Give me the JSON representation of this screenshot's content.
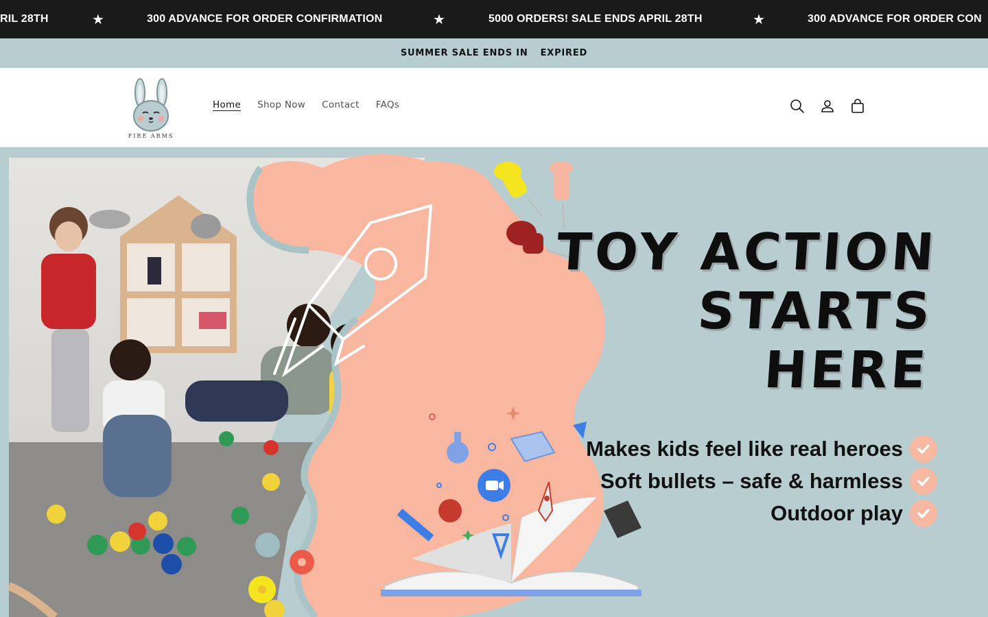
{
  "ticker": {
    "items": [
      "RIL 28TH",
      "300 ADVANCE FOR ORDER CONFIRMATION",
      "5000 ORDERS! SALE ENDS APRIL 28TH",
      "300 ADVANCE FOR ORDER CON"
    ],
    "separator": "★"
  },
  "countdown": {
    "label": "SUMMER SALE ENDS IN",
    "status": "EXPIRED"
  },
  "header": {
    "logo_text": "FIRE ARMS",
    "nav": [
      {
        "label": "Home",
        "active": true
      },
      {
        "label": "Shop Now",
        "active": false
      },
      {
        "label": "Contact",
        "active": false
      },
      {
        "label": "FAQs",
        "active": false
      }
    ],
    "icons": [
      "search-icon",
      "account-icon",
      "cart-icon"
    ]
  },
  "hero": {
    "headline_line1": "TOY ACTION",
    "headline_line2": "STARTS HERE",
    "features": [
      "Makes kids feel like real heroes",
      "Soft bullets – safe & harmless",
      "Outdoor play"
    ],
    "colors": {
      "background": "#b8cdd0",
      "blob": "#f9b7a0",
      "check": "#f7b8a2"
    }
  }
}
